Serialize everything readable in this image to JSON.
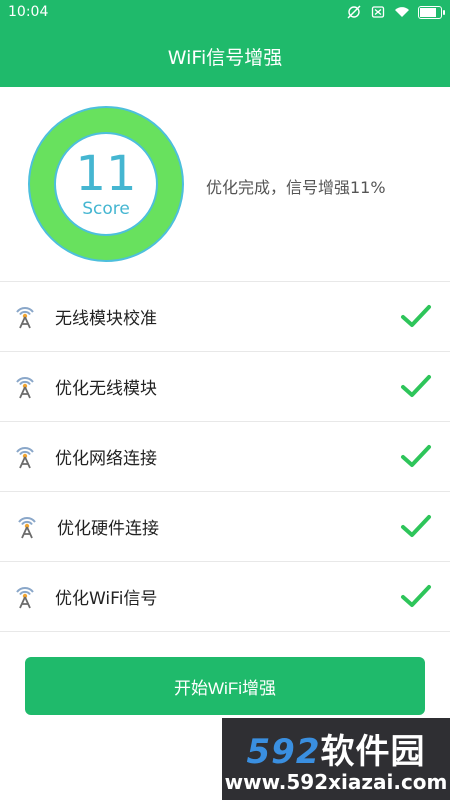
{
  "status_bar": {
    "time": "10:04"
  },
  "header": {
    "title": "WiFi信号增强"
  },
  "score": {
    "value": "11",
    "label": "Score",
    "result_text": "优化完成，信号增强11%"
  },
  "tasks": [
    {
      "label": "无线模块校准",
      "status": "done"
    },
    {
      "label": "优化无线模块",
      "status": "done"
    },
    {
      "label": "优化网络连接",
      "status": "done"
    },
    {
      "label": "优化硬件连接",
      "status": "done"
    },
    {
      "label": "优化WiFi信号",
      "status": "done"
    }
  ],
  "button": {
    "label": "开始WiFi增强"
  },
  "watermark": {
    "brand_number": "592",
    "brand_text": "软件园",
    "url": "www.592xiazai.com"
  },
  "colors": {
    "primary": "#1fba6b",
    "ring": "#68e15e",
    "score_text": "#45b6d1",
    "check": "#2ec55a"
  }
}
